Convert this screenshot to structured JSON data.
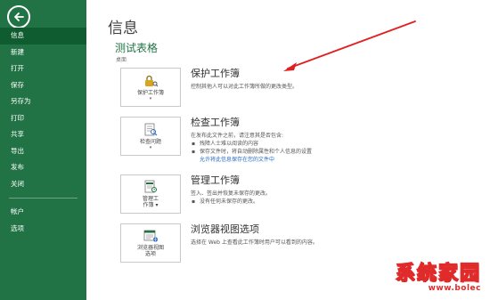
{
  "sidebar": {
    "items": [
      {
        "label": "信息",
        "active": true
      },
      {
        "label": "新建"
      },
      {
        "label": "打开"
      },
      {
        "label": "保存"
      },
      {
        "label": "另存为"
      },
      {
        "label": "打印"
      },
      {
        "label": "共享"
      },
      {
        "label": "导出"
      },
      {
        "label": "发布"
      },
      {
        "label": "关闭"
      }
    ],
    "bottom_items": [
      {
        "label": "帐户"
      },
      {
        "label": "选项"
      }
    ],
    "colors": {
      "background": "#217346",
      "active": "#0e5c2f"
    }
  },
  "main": {
    "title": "信息",
    "workbook_name": "测试表格",
    "workbook_path": "桌面",
    "sections": [
      {
        "tile_label_1": "保护工作簿",
        "tile_caret": "▾",
        "icon": "lock-key-icon",
        "title": "保护工作簿",
        "desc": "控制其他人可以对此工作簿所做的更改类型。"
      },
      {
        "tile_label_1": "检查问题",
        "tile_caret": "▾",
        "icon": "inspect-document-icon",
        "title": "检查工作簿",
        "desc": "在发布此文件之前，请注意其是否包含:",
        "bullets": [
          "残障人士难以阅读的内容",
          "保存文件时，将自动删除属性和个人信息的设置"
        ],
        "link": "允许将此信息保存在您的文件中"
      },
      {
        "tile_label_1": "管理工",
        "tile_label_2": "作簿",
        "tile_caret": "▾",
        "icon": "manage-workbook-icon",
        "title": "管理工作簿",
        "desc": "签入、签出并恢复未保存的更改。",
        "bullets": [
          "没有任何未保存的更改。"
        ]
      },
      {
        "tile_label_1": "浏览器视图",
        "tile_label_2": "选项",
        "icon": "browser-view-icon",
        "title": "浏览器视图选项",
        "desc": "选择在 Web 上查看此工作簿时用户可以看到的内容。"
      }
    ]
  },
  "watermark": {
    "title": "系统家园",
    "url": "www.bolec"
  },
  "accent_colors": {
    "excel_green": "#217346",
    "arrow_red": "#e02020",
    "link_blue": "#2b6cc4"
  }
}
